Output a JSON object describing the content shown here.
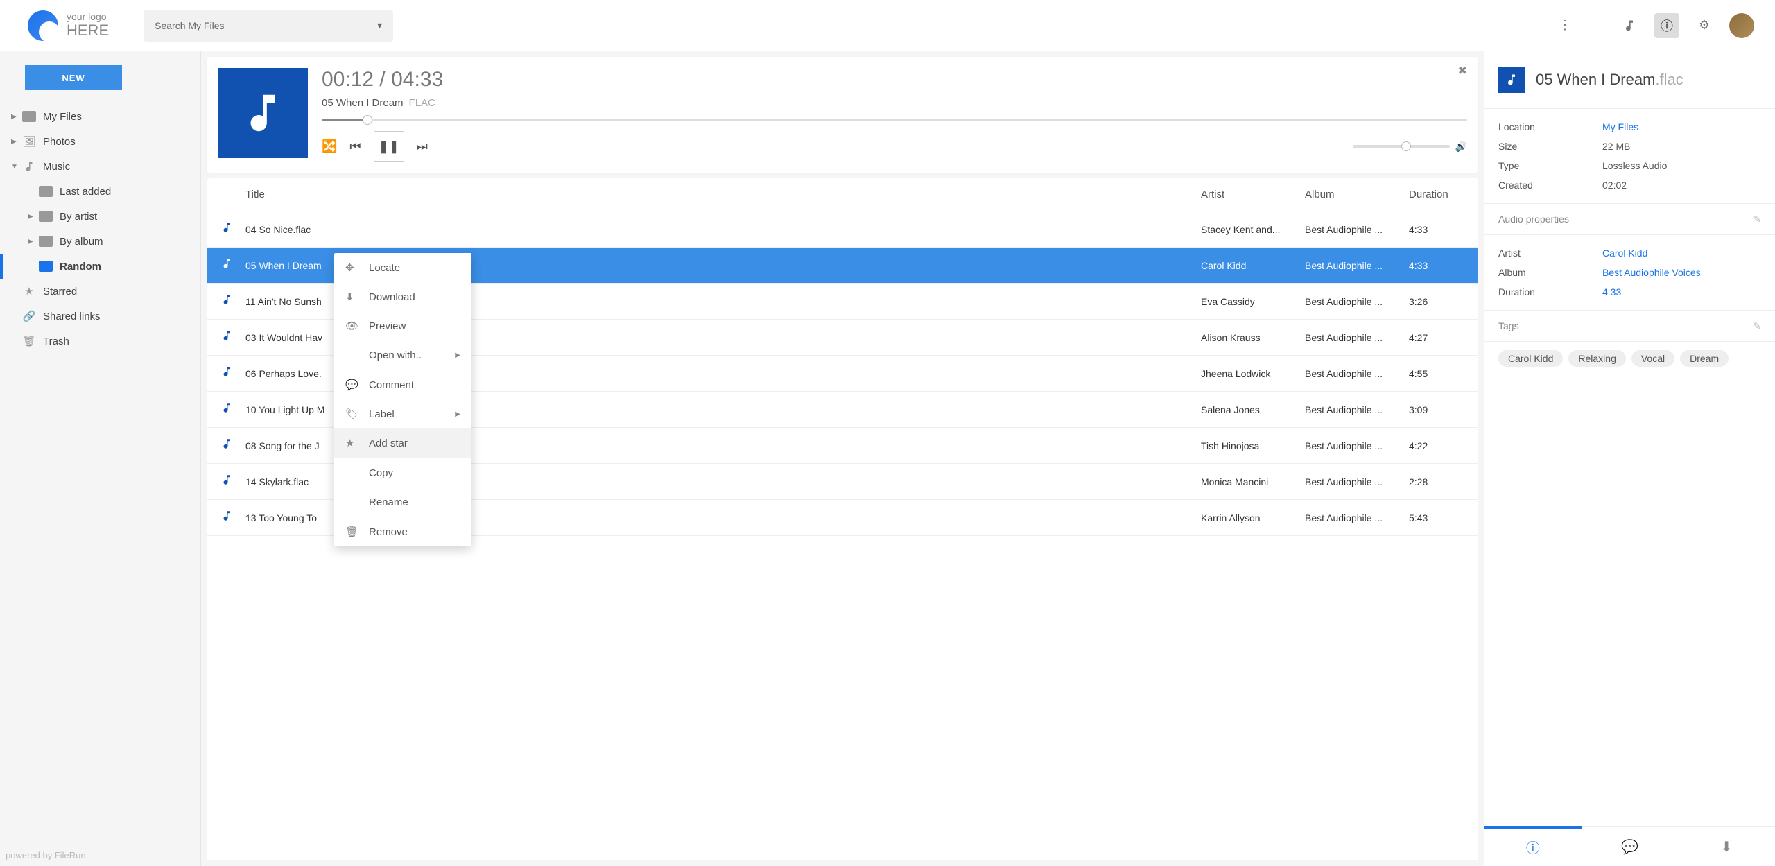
{
  "logo": {
    "line1": "your logo",
    "line2": "HERE"
  },
  "search": {
    "placeholder": "Search My Files"
  },
  "sidebar": {
    "new_button": "NEW",
    "items": [
      {
        "label": "My Files",
        "indent": 0,
        "icon": "folder",
        "exp": "▶"
      },
      {
        "label": "Photos",
        "indent": 0,
        "icon": "photo",
        "exp": "▶"
      },
      {
        "label": "Music",
        "indent": 0,
        "icon": "music",
        "exp": "▼"
      },
      {
        "label": "Last added",
        "indent": 1,
        "icon": "folder",
        "exp": ""
      },
      {
        "label": "By artist",
        "indent": 1,
        "icon": "folder",
        "exp": "▶"
      },
      {
        "label": "By album",
        "indent": 1,
        "icon": "folder",
        "exp": "▶"
      },
      {
        "label": "Random",
        "indent": 1,
        "icon": "folder",
        "exp": "",
        "active": true
      },
      {
        "label": "Starred",
        "indent": 0,
        "icon": "star",
        "exp": ""
      },
      {
        "label": "Shared links",
        "indent": 0,
        "icon": "link",
        "exp": ""
      },
      {
        "label": "Trash",
        "indent": 0,
        "icon": "trash",
        "exp": ""
      }
    ],
    "powered": "powered by FileRun"
  },
  "player": {
    "elapsed": "00:12",
    "sep": " / ",
    "total": "04:33",
    "title": "05 When I Dream",
    "format": "FLAC"
  },
  "table": {
    "headers": {
      "title": "Title",
      "artist": "Artist",
      "album": "Album",
      "duration": "Duration"
    },
    "rows": [
      {
        "title": "04 So Nice.flac",
        "artist": "Stacey Kent and...",
        "album": "Best Audiophile ...",
        "dur": "4:33"
      },
      {
        "title": "05 When I Dream",
        "artist": "Carol Kidd",
        "album": "Best Audiophile ...",
        "dur": "4:33",
        "selected": true
      },
      {
        "title": "11 Ain't No Sunsh",
        "artist": "Eva Cassidy",
        "album": "Best Audiophile ...",
        "dur": "3:26"
      },
      {
        "title": "03 It Wouldnt Hav",
        "artist": "Alison Krauss",
        "album": "Best Audiophile ...",
        "dur": "4:27"
      },
      {
        "title": "06 Perhaps Love.",
        "artist": "Jheena Lodwick",
        "album": "Best Audiophile ...",
        "dur": "4:55"
      },
      {
        "title": "10 You Light Up M",
        "artist": "Salena Jones",
        "album": "Best Audiophile ...",
        "dur": "3:09"
      },
      {
        "title": "08 Song for the J",
        "artist": "Tish Hinojosa",
        "album": "Best Audiophile ...",
        "dur": "4:22"
      },
      {
        "title": "14 Skylark.flac",
        "artist": "Monica Mancini",
        "album": "Best Audiophile ...",
        "dur": "2:28"
      },
      {
        "title": "13 Too Young To",
        "artist": "Karrin Allyson",
        "album": "Best Audiophile ...",
        "dur": "5:43"
      }
    ]
  },
  "context_menu": {
    "items": [
      {
        "label": "Locate",
        "icon": "✥"
      },
      {
        "label": "Download",
        "icon": "⬇"
      },
      {
        "label": "Preview",
        "icon": "👁"
      },
      {
        "label": "Open with..",
        "icon": "",
        "arrow": true,
        "sep_after": true
      },
      {
        "label": "Comment",
        "icon": "💬"
      },
      {
        "label": "Label",
        "icon": "🏷",
        "arrow": true
      },
      {
        "label": "Add star",
        "icon": "★",
        "hover": true,
        "sep_after": true
      },
      {
        "label": "Copy",
        "icon": ""
      },
      {
        "label": "Rename",
        "icon": "",
        "sep_after": true
      },
      {
        "label": "Remove",
        "icon": "🗑"
      }
    ]
  },
  "details": {
    "title": "05 When I Dream",
    "ext": ".flac",
    "sections": {
      "location_label": "Location",
      "location_value": "My Files",
      "size_label": "Size",
      "size_value": "22 MB",
      "type_label": "Type",
      "type_value": "Lossless Audio",
      "created_label": "Created",
      "created_value": "02:02",
      "audio_props_header": "Audio properties",
      "artist_label": "Artist",
      "artist_value": "Carol Kidd",
      "album_label": "Album",
      "album_value": "Best Audiophile Voices",
      "duration_label": "Duration",
      "duration_value": "4:33",
      "tags_header": "Tags"
    },
    "tags": [
      "Carol Kidd",
      "Relaxing",
      "Vocal",
      "Dream"
    ]
  }
}
